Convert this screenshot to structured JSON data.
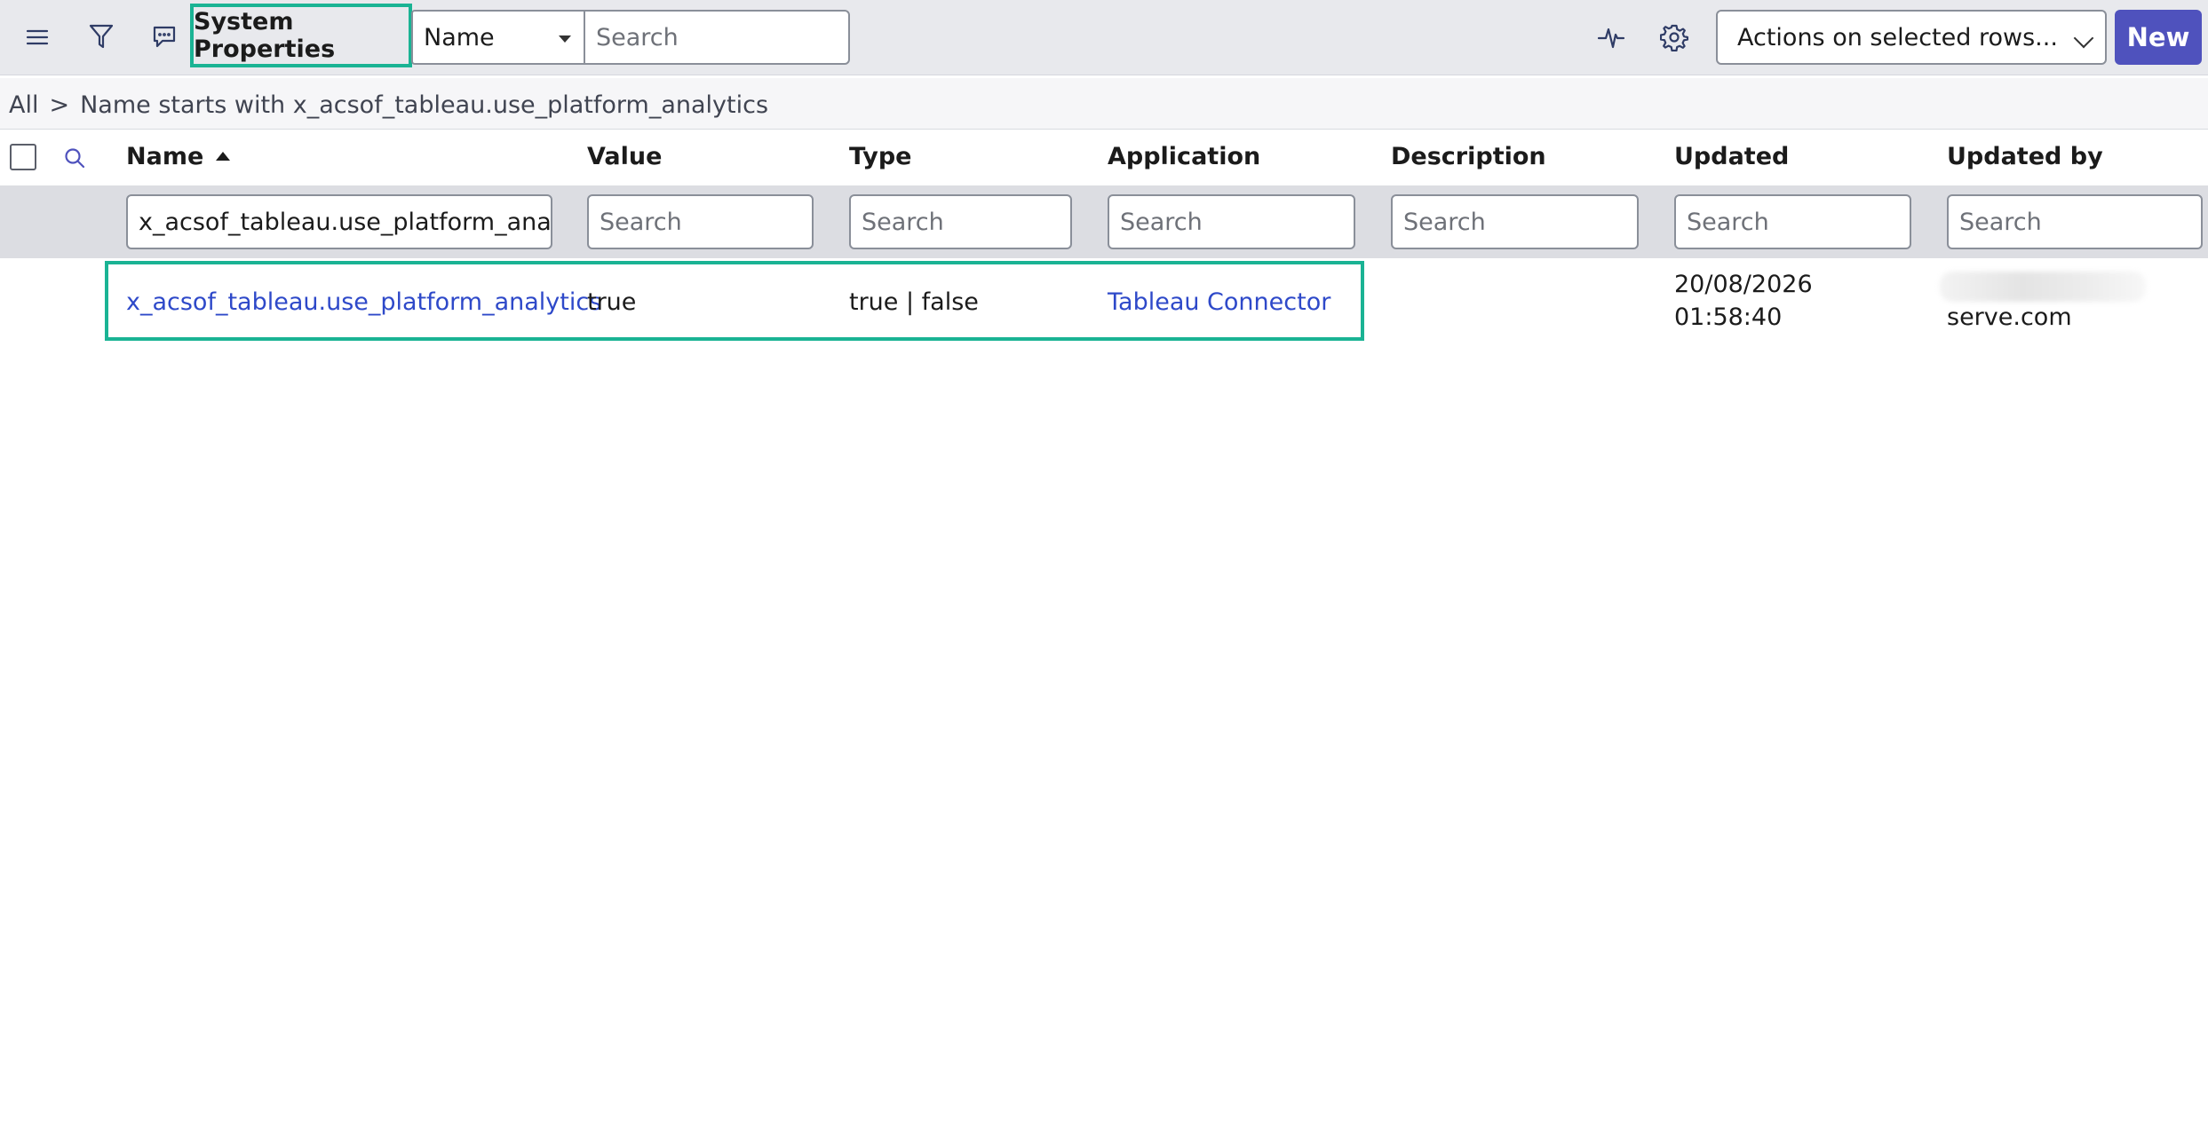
{
  "toolbar": {
    "title": "System Properties",
    "field_select_value": "Name",
    "search_placeholder": "Search",
    "actions_label": "Actions on selected rows...",
    "new_label": "New",
    "icons": [
      "hamburger-menu-icon",
      "filter-icon",
      "chat-bubble-icon",
      "activity-pulse-icon",
      "gear-icon"
    ],
    "accent_color": "#4f52bd",
    "highlight_color": "#1ab394"
  },
  "breadcrumb": {
    "root": "All",
    "separator": ">",
    "condition": "Name starts with x_acsof_tableau.use_platform_analytics"
  },
  "table": {
    "columns": [
      "Name",
      "Value",
      "Type",
      "Application",
      "Description",
      "Updated",
      "Updated by"
    ],
    "sort_column": "Name",
    "sort_direction": "ascending",
    "filters": {
      "name_value": "x_acsof_tableau.use_platform_analyt",
      "placeholder": "Search"
    },
    "rows": [
      {
        "name": "x_acsof_tableau.use_platform_analytics",
        "value": "true",
        "type": "true | false",
        "application": "Tableau Connector",
        "description": "",
        "updated_date": "20/08/2026",
        "updated_time": "01:58:40",
        "updated_by": "serve.com"
      }
    ]
  }
}
